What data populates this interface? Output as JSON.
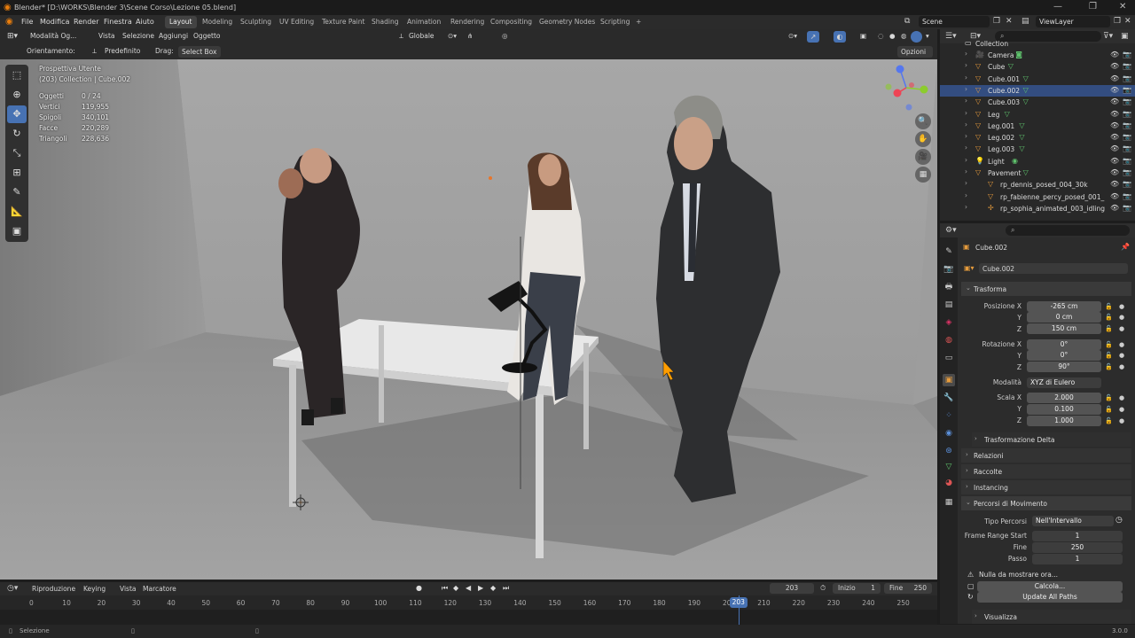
{
  "title_bar": {
    "text": "Blender* [D:\\WORKS\\Blender 3\\Scene Corso\\Lezione 05.blend]"
  },
  "menu": [
    "File",
    "Modifica",
    "Render",
    "Finestra",
    "Aiuto"
  ],
  "workspaces": [
    "Layout",
    "Modeling",
    "Sculpting",
    "UV Editing",
    "Texture Paint",
    "Shading",
    "Animation",
    "Rendering",
    "Compositing",
    "Geometry Nodes",
    "Scripting",
    "+"
  ],
  "scene": {
    "label": "Scene",
    "view_layer": "ViewLayer"
  },
  "viewport_header": {
    "mode": "Modalità Og...",
    "items": [
      "Vista",
      "Selezione",
      "Aggiungi",
      "Oggetto"
    ],
    "orientation": "Globale"
  },
  "tool_settings": {
    "orient_label": "Orientamento:",
    "orient_value": "Predefinito",
    "drag_label": "Drag:",
    "drag_value": "Select Box",
    "options": "Opzioni"
  },
  "overlay_text": {
    "view": "Prospettiva Utente",
    "context": "(203) Collection | Cube.002"
  },
  "stats": [
    {
      "label": "Oggetti",
      "value": "0 / 24"
    },
    {
      "label": "Vertici",
      "value": "119,955"
    },
    {
      "label": "Spigoli",
      "value": "340,101"
    },
    {
      "label": "Facce",
      "value": "220,289"
    },
    {
      "label": "Triangoli",
      "value": "228,636"
    }
  ],
  "outliner": {
    "collection": "Collection",
    "items": [
      {
        "name": "Camera",
        "icon": "camera-icon",
        "extra": "camera-data-icon"
      },
      {
        "name": "Cube",
        "icon": "mesh-icon",
        "extra": "mesh-data-icon"
      },
      {
        "name": "Cube.001",
        "icon": "mesh-icon",
        "extra": "mesh-data-icon"
      },
      {
        "name": "Cube.002",
        "icon": "mesh-icon",
        "extra": "mesh-data-icon",
        "selected": true
      },
      {
        "name": "Cube.003",
        "icon": "mesh-icon",
        "extra": "mesh-data-icon"
      },
      {
        "name": "Leg",
        "icon": "mesh-icon",
        "extra": "mesh-data-icon"
      },
      {
        "name": "Leg.001",
        "icon": "mesh-icon",
        "extra": "mesh-data-icon"
      },
      {
        "name": "Leg.002",
        "icon": "mesh-icon",
        "extra": "mesh-data-icon"
      },
      {
        "name": "Leg.003",
        "icon": "mesh-icon",
        "extra": "mesh-data-icon"
      },
      {
        "name": "Light",
        "icon": "light-icon",
        "extra": "light-data-icon"
      },
      {
        "name": "Pavement",
        "icon": "mesh-icon",
        "extra": "mesh-data-icon"
      },
      {
        "name": "rp_dennis_posed_004_30k",
        "icon": "mesh-icon",
        "extra": ""
      },
      {
        "name": "rp_fabienne_percy_posed_001_",
        "icon": "mesh-icon",
        "extra": ""
      },
      {
        "name": "rp_sophia_animated_003_idling",
        "icon": "armature-icon",
        "extra": ""
      }
    ]
  },
  "properties": {
    "object_name": "Cube.002",
    "data_name": "Cube.002",
    "transform_title": "Trasforma",
    "location": {
      "label": "Posizione X",
      "x": "-265 cm",
      "y": "0 cm",
      "z": "150 cm"
    },
    "rotation": {
      "label": "Rotazione X",
      "x": "0°",
      "y": "0°",
      "z": "90°"
    },
    "rot_mode": {
      "label": "Modalità",
      "value": "XYZ di Eulero"
    },
    "scale": {
      "label": "Scala X",
      "x": "2.000",
      "y": "0.100",
      "z": "1.000"
    },
    "axis_y": "Y",
    "axis_z": "Z",
    "delta": "Trasformazione Delta",
    "panels": [
      "Relazioni",
      "Raccolte",
      "Instancing"
    ],
    "motion": {
      "title": "Percorsi di Movimento",
      "type_label": "Tipo Percorsi",
      "type_value": "Nell'Intervallo",
      "start_label": "Frame Range Start",
      "start_value": "1",
      "end_label": "Fine",
      "end_value": "250",
      "step_label": "Passo",
      "step_value": "1",
      "info": "Nulla da mostrare ora...",
      "calc": "Calcola...",
      "update": "Update All Paths"
    },
    "visual": "Visualizza"
  },
  "timeline": {
    "items": [
      "Riproduzione",
      "Keying",
      "Vista",
      "Marcatore"
    ],
    "current": "203",
    "start_label": "Inizio",
    "start": "1",
    "end_label": "Fine",
    "end": "250",
    "ticks": [
      "0",
      "10",
      "20",
      "30",
      "40",
      "50",
      "60",
      "70",
      "80",
      "90",
      "100",
      "110",
      "120",
      "130",
      "140",
      "150",
      "160",
      "170",
      "180",
      "190",
      "200",
      "210",
      "220",
      "230",
      "240",
      "250"
    ],
    "playhead": "203"
  },
  "status": {
    "left": "Selezione",
    "version": "3.0.0"
  },
  "colors": {
    "accent": "#4772b3",
    "playhead": "#4772b3",
    "mesh_icon": "#e59b3c",
    "data_icon": "#5fc36d"
  }
}
